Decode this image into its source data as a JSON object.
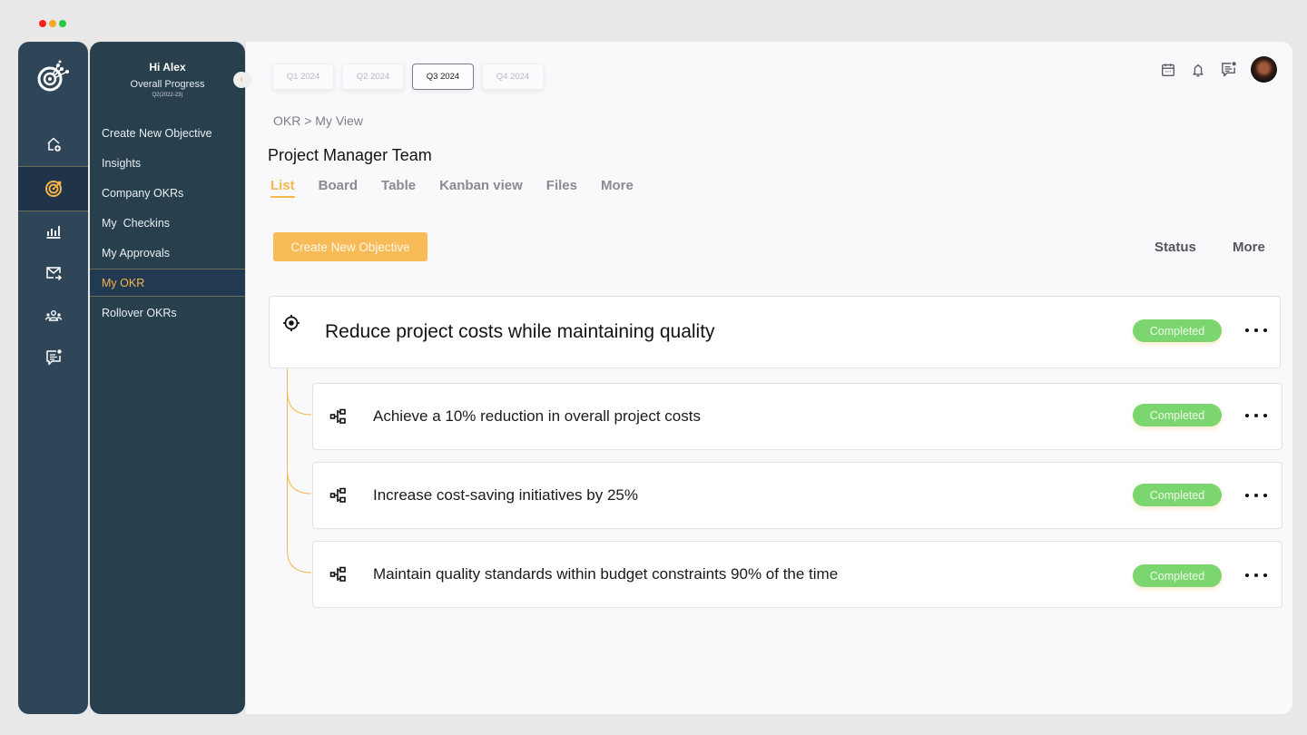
{
  "window": {
    "dots": [
      {
        "name": "close",
        "color": "#ff1f1f"
      },
      {
        "name": "minimize",
        "color": "#f6a623"
      },
      {
        "name": "maximize",
        "color": "#28c840"
      }
    ]
  },
  "rail": {
    "logo": "target-network-logo",
    "items": [
      {
        "icon": "home-add-icon",
        "active": false
      },
      {
        "icon": "target-icon",
        "active": true
      },
      {
        "icon": "bar-chart-icon",
        "active": false
      },
      {
        "icon": "mail-forward-icon",
        "active": false
      },
      {
        "icon": "team-icon",
        "active": false
      },
      {
        "icon": "message-notification-icon",
        "active": false
      }
    ]
  },
  "sidepanel": {
    "greeting": "Hi Alex",
    "progress_label": "Overall Progress",
    "period": "Q2(2022-23)",
    "collapse_icon": "chevron-left-icon",
    "items": [
      {
        "label": "Create New Objective",
        "active": false
      },
      {
        "label": "Insights",
        "active": false
      },
      {
        "label": "Company OKRs",
        "active": false
      },
      {
        "label": "My  Checkins",
        "active": false
      },
      {
        "label": "My Approvals",
        "active": false
      },
      {
        "label": "My OKR",
        "active": true
      },
      {
        "label": "Rollover OKRs",
        "active": false
      }
    ]
  },
  "header": {
    "quarters": [
      {
        "label": "Q1 2024",
        "active": false
      },
      {
        "label": "Q2 2024",
        "active": false
      },
      {
        "label": "Q3 2024",
        "active": true
      },
      {
        "label": "Q4 2024",
        "active": false
      }
    ],
    "icons": [
      "calendar-icon",
      "bell-icon",
      "message-notification-icon",
      "user-avatar"
    ]
  },
  "breadcrumb": "OKR > My View",
  "page_title": "Project Manager Team",
  "tabs": [
    {
      "label": "List",
      "active": true
    },
    {
      "label": "Board",
      "active": false
    },
    {
      "label": "Table",
      "active": false
    },
    {
      "label": "Kanban view",
      "active": false
    },
    {
      "label": "Files",
      "active": false
    },
    {
      "label": "More",
      "active": false
    }
  ],
  "toolbar": {
    "create_label": "Create New Objective",
    "status_label": "Status",
    "more_label": "More"
  },
  "colors": {
    "accent": "#f5b64b",
    "rail_bg": "#2f4659",
    "panel_bg": "#283f4e",
    "completed": "#7cd66f"
  },
  "objective": {
    "icon": "target-crosshair-icon",
    "title": "Reduce project costs while maintaining quality",
    "status": "Completed",
    "key_results": [
      {
        "icon": "hierarchy-icon",
        "title": "Achieve a 10% reduction in overall project costs",
        "status": "Completed"
      },
      {
        "icon": "hierarchy-icon",
        "title": "Increase cost-saving initiatives by 25%",
        "status": "Completed"
      },
      {
        "icon": "hierarchy-icon",
        "title": "Maintain quality standards within budget constraints 90% of the time",
        "status": "Completed"
      }
    ]
  }
}
